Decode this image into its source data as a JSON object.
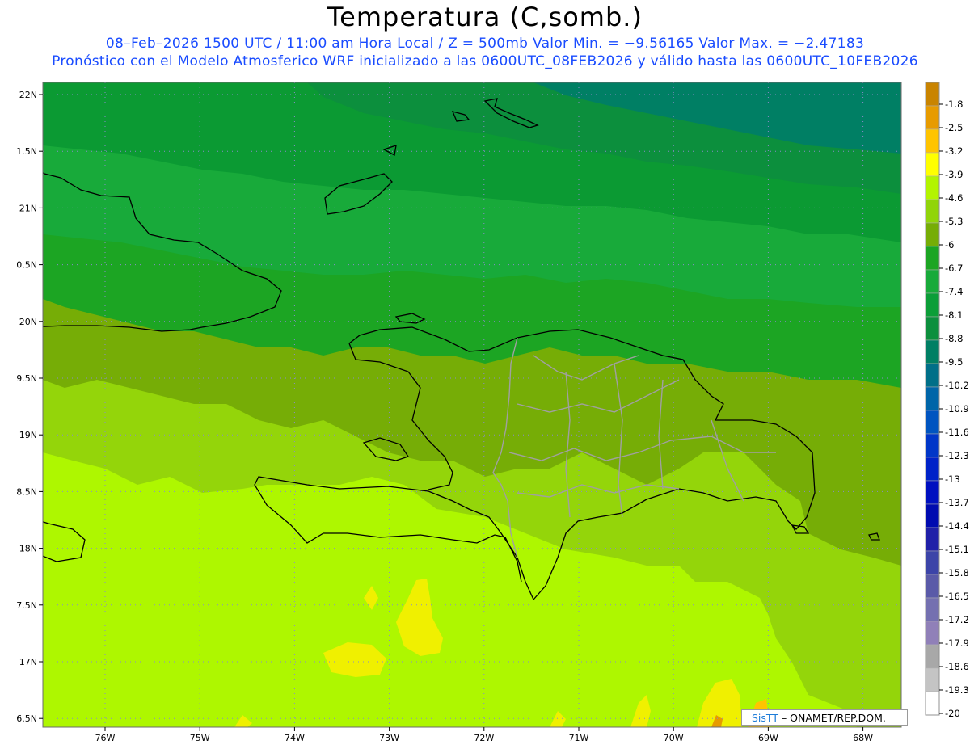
{
  "header": {
    "title": "Temperatura (C,somb.)",
    "line1": "08–Feb–2026  1500 UTC / 11:00 am Hora Local / Z = 500mb  Valor Min. = −9.56165  Valor Max. = −2.47183",
    "line2": "Pronóstico con el Modelo Atmosferico WRF inicializado a las 0600UTC_08FEB2026 y válido hasta las  0600UTC_10FEB2026"
  },
  "map": {
    "lat_ticks": [
      "22N",
      "1.5N",
      "21N",
      "0.5N",
      "20N",
      "9.5N",
      "19N",
      "8.5N",
      "18N",
      "7.5N",
      "17N",
      "6.5N"
    ],
    "lon_ticks": [
      "76W",
      "75W",
      "74W",
      "73W",
      "72W",
      "71W",
      "70W",
      "69W",
      "68W"
    ],
    "gridlines": true,
    "colors": {
      "c_m5_3": "#94d50a",
      "c_m4_6": "#aef700",
      "c_m3_9": "#f0f000",
      "c_m6_0": "#76ad06",
      "c_m6_7": "#1ca523",
      "c_m8_1": "#0b9a33",
      "c_m8_8": "#0c8f3d",
      "c_m9_5": "#007f64"
    }
  },
  "colorbar": {
    "labels": [
      "-1.8",
      "-2.5",
      "-3.2",
      "-3.9",
      "-4.6",
      "-5.3",
      "-6",
      "-6.7",
      "-7.4",
      "-8.1",
      "-8.8",
      "-9.5",
      "-10.2",
      "-10.9",
      "-11.6",
      "-12.3",
      "-13",
      "-13.7",
      "-14.4",
      "-15.1",
      "-15.8",
      "-16.5",
      "-17.2",
      "-17.9",
      "-18.6",
      "-19.3",
      "-20"
    ],
    "colors": [
      "#c98400",
      "#e79b00",
      "#ffc400",
      "#ffff00",
      "#b3f400",
      "#91d40a",
      "#76ad06",
      "#1ca523",
      "#18aa3a",
      "#0c9e38",
      "#0c8f3d",
      "#007f64",
      "#006f88",
      "#0065a8",
      "#0054c0",
      "#0036c8",
      "#0022c8",
      "#0010c0",
      "#000bb0",
      "#2020a8",
      "#3c44a8",
      "#5a5aa8",
      "#7470b0",
      "#9080b8",
      "#a8a8a8",
      "#c4c4c4",
      "#ffffff"
    ]
  },
  "credit": {
    "sis": "SisTT",
    "rest": " –  ONAMET/REP.DOM."
  }
}
